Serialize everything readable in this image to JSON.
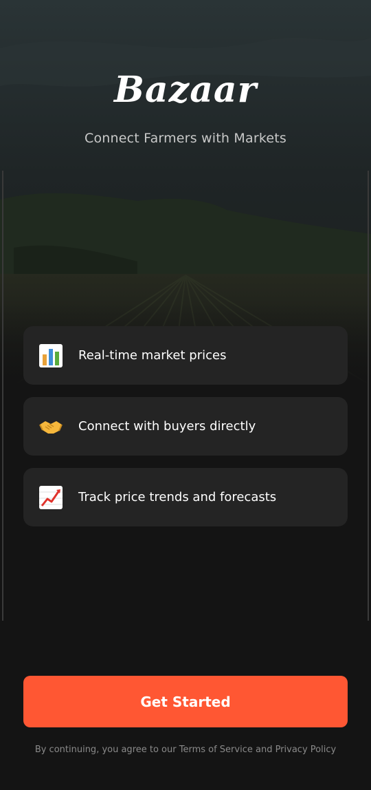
{
  "app": {
    "title": "Bazaar",
    "subtitle": "Connect Farmers with Markets"
  },
  "features": [
    {
      "icon": "bar-chart-icon",
      "label": "Real-time market prices"
    },
    {
      "icon": "handshake-icon",
      "label": "Connect with buyers directly"
    },
    {
      "icon": "trending-up-icon",
      "label": "Track price trends and forecasts"
    }
  ],
  "cta": {
    "label": "Get Started"
  },
  "legal": {
    "text": "By continuing, you agree to our Terms of Service and Privacy Policy"
  },
  "colors": {
    "background": "#141414",
    "card": "#242424",
    "accent": "#ff5733"
  }
}
